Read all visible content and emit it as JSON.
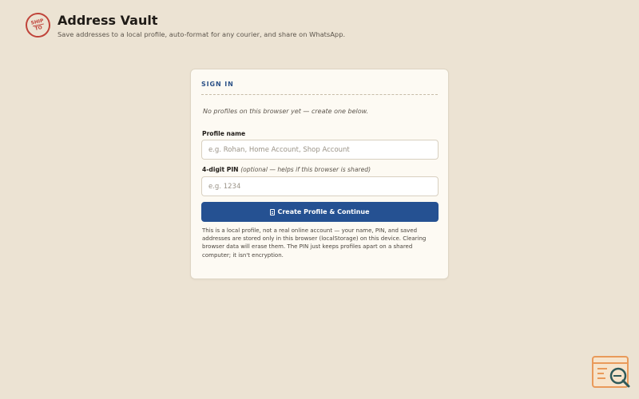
{
  "header": {
    "logo_line1": "SHIP",
    "logo_line2": "TO",
    "title": "Address Vault",
    "subtitle": "Save addresses to a local profile, auto-format for any courier, and share on WhatsApp."
  },
  "signin": {
    "title": "SIGN IN",
    "notice": "No profiles on this browser yet — create one below.",
    "profile_label": "Profile name",
    "profile_placeholder": "e.g. Rohan, Home Account, Shop Account",
    "profile_value": "",
    "pin_label": "4-digit PIN",
    "pin_optional": "(optional — helps if this browser is shared)",
    "pin_placeholder": "e.g. 1234",
    "pin_value": "",
    "create_button": "Create Profile & Continue",
    "note": "This is a local profile, not a real online account — your name, PIN, and saved addresses are stored only in this browser (localStorage) on this device. Clearing browser data will erase them. The PIN just keeps profiles apart on a shared computer; it isn't encryption."
  },
  "colors": {
    "background": "#ece3d3",
    "accent": "#255192",
    "logo_red": "#c0443a",
    "card": "#fdfaf3"
  },
  "icons": {
    "logo": "ship-to-stamp-icon",
    "button": "document-icon",
    "corner": "search-code-icon"
  }
}
